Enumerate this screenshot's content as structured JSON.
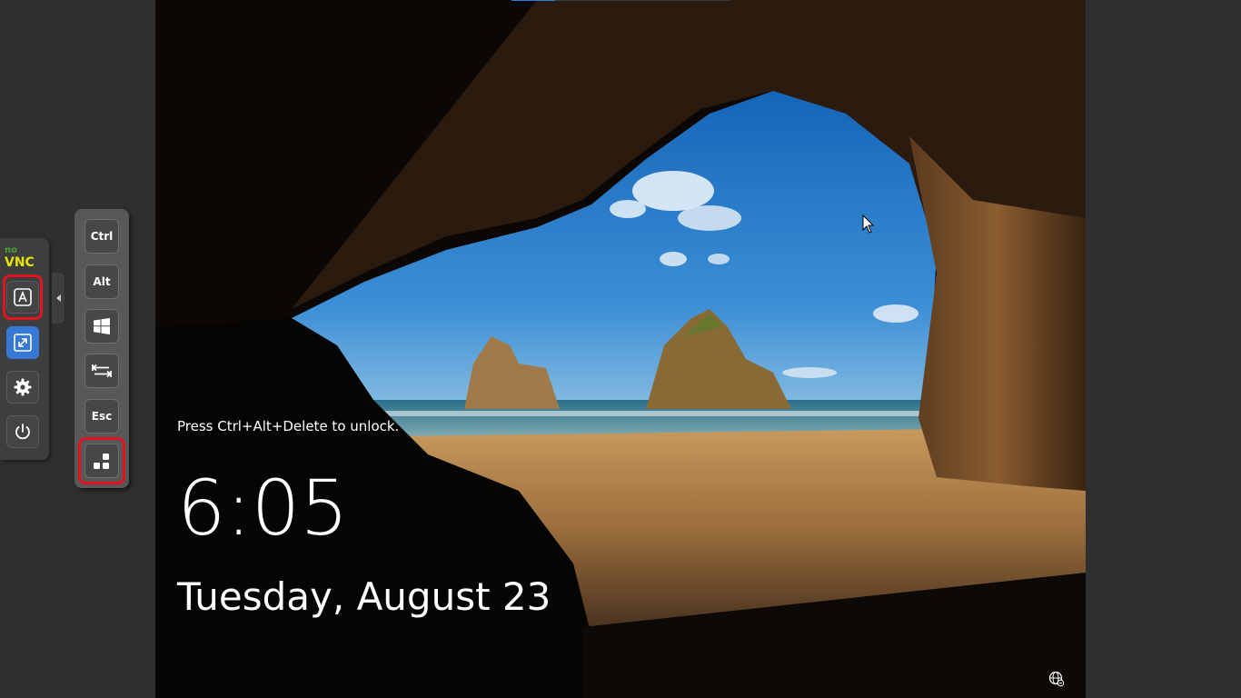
{
  "lockscreen": {
    "unlock_hint": "Press Ctrl+Alt+Delete to unlock.",
    "time": "6:05",
    "date": "Tuesday, August 23",
    "network_icon": "globe-network-icon"
  },
  "novnc": {
    "logo_top": "no",
    "logo_bottom": "VNC",
    "buttons": [
      {
        "name": "extra-keys-button",
        "icon": "keyboard-a-icon",
        "highlighted": true
      },
      {
        "name": "fullscreen-button",
        "icon": "fullscreen-icon",
        "selected": true
      },
      {
        "name": "settings-button",
        "icon": "gear-icon"
      },
      {
        "name": "disconnect-button",
        "icon": "power-icon"
      }
    ],
    "colors": {
      "accent": "#3678d4",
      "highlight_ring": "#e3141f",
      "logo_no": "#4ca233",
      "logo_vnc": "#e6e600"
    }
  },
  "extra_keys": {
    "ctrl_label": "Ctrl",
    "alt_label": "Alt",
    "windows_icon": "windows-logo-icon",
    "tab_icon": "tab-icon",
    "esc_label": "Esc",
    "ctrl_alt_del_icon": "ctrl-alt-del-icon"
  }
}
